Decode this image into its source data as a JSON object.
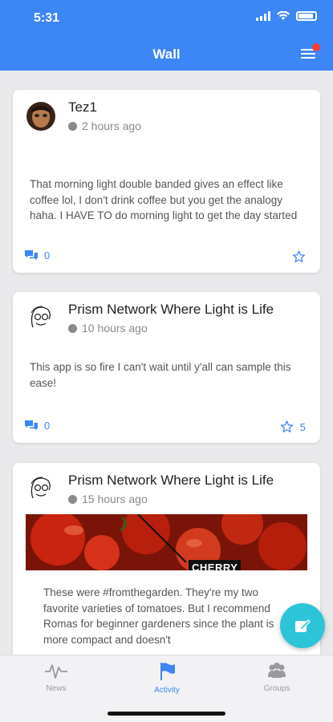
{
  "status_bar": {
    "time": "5:31"
  },
  "header": {
    "title": "Wall"
  },
  "posts": [
    {
      "author": "Tez1",
      "time": "2 hours ago",
      "text": "That morning light double banded gives an effect like coffee lol, I don't drink coffee but you get the analogy haha. I HAVE TO do morning light to get the day started",
      "comments": "0",
      "stars": ""
    },
    {
      "author": "Prism Network Where Light is Life",
      "time": "10 hours ago",
      "text": "This app is so fire I can't wait until y'all can sample this ease!",
      "comments": "0",
      "stars": "5"
    },
    {
      "author": "Prism Network Where Light is Life",
      "time": "15 hours ago",
      "image_label": "CHERRY",
      "text": "These were #fromthegarden. They're my two favorite varieties of tomatoes. But I recommend Romas for beginner gardeners since the plant is more compact and doesn't"
    }
  ],
  "tabs": [
    {
      "label": "News",
      "icon": "pulse-icon"
    },
    {
      "label": "Activity",
      "icon": "flag-icon"
    },
    {
      "label": "Groups",
      "icon": "groups-icon"
    }
  ],
  "colors": {
    "accent": "#3d86f5",
    "fab": "#2ec4d8",
    "badge": "#ff3b30"
  }
}
